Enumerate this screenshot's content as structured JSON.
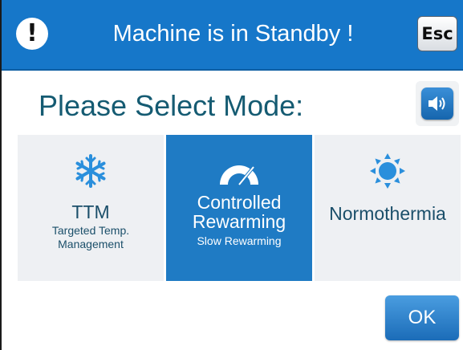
{
  "header": {
    "alert_symbol": "!",
    "title": "Machine is in Standby !",
    "esc_label": "Esc",
    "color": "#1677c9"
  },
  "mode_select": {
    "title": "Please Select Mode:",
    "sound_icon": "speaker-volume-icon",
    "modes": [
      {
        "name": "TTM",
        "subtitle_line1": "Targeted Temp.",
        "subtitle_line2": "Management",
        "icon": "snowflake-icon",
        "selected": false
      },
      {
        "name_line1": "Controlled",
        "name_line2": "Rewarming",
        "subtitle": "Slow Rewarming",
        "icon": "gauge-icon",
        "selected": true
      },
      {
        "name": "Normothermia",
        "icon": "sun-icon",
        "selected": false
      }
    ]
  },
  "footer": {
    "ok_label": "OK"
  },
  "colors": {
    "accent": "#1f7bc4",
    "title_text": "#155b72",
    "tile_bg": "#eef0f3"
  }
}
